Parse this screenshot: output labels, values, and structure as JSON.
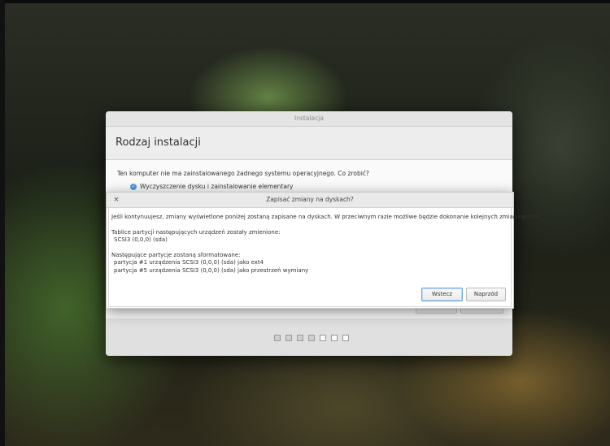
{
  "installer": {
    "window_title": "Instalacja",
    "header_title": "Rodzaj instalacji",
    "question": "Ten komputer nie ma zainstalowanego żadnego systemu operacyjnego. Co zrobić?",
    "option_selected": "Wyczyszczenie dysku i zainstalowanie elementary",
    "progress_steps_total": 7,
    "progress_steps_done": 4
  },
  "dialog": {
    "title": "Zapisać zmiany na dyskach?",
    "close_icon": "×",
    "intro": "Jeśli kontynuujesz, zmiany wyświetlone poniżej zostaną zapisane na dyskach. W przeciwnym razie możliwe będzie dokonanie kolejnych zmian ręcznie.",
    "partition_tables_heading": "Tablice partycji następujących urządzeń zostały zmienione:",
    "partition_tables_device": "SCSI3 (0,0,0) (sda)",
    "format_heading": "Następujące partycje zostaną sformatowane:",
    "format_line_1": "partycja #1 urządzenia SCSI3 (0,0,0) (sda) jako ext4",
    "format_line_2": "partycja #5 urządzenia SCSI3 (0,0,0) (sda) jako przestrzeń wymiany",
    "back_button": "Wstecz",
    "forward_button": "Naprzód"
  },
  "colors": {
    "accent": "#4a9ae0",
    "default_button_border": "#6aa7e6"
  }
}
